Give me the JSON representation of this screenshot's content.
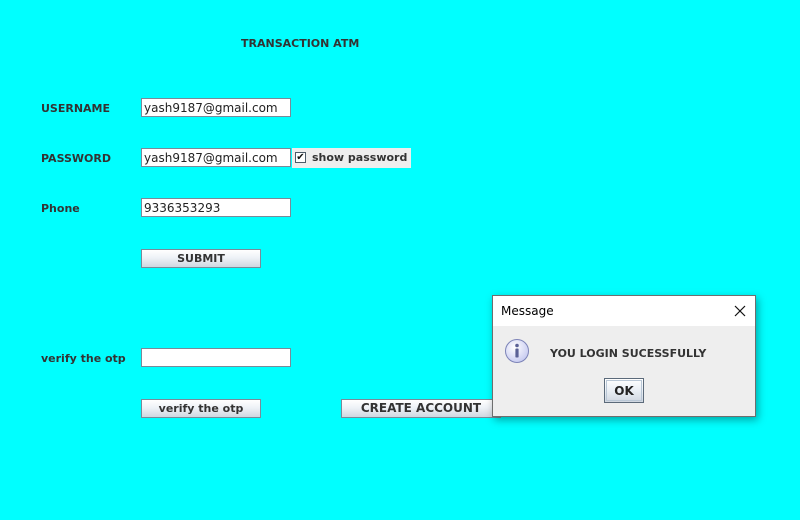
{
  "colors": {
    "background": "#00ffff",
    "dialog_bg": "#eeeeee"
  },
  "form": {
    "title": "TRANSACTION ATM",
    "username_label": "USERNAME",
    "username_value": "yash9187@gmail.com",
    "password_label": "PASSWORD",
    "password_value": "yash9187@gmail.com",
    "show_password_label": "show password",
    "show_password_checked": true,
    "phone_label": "Phone",
    "phone_value": "9336353293",
    "submit_label": "SUBMIT",
    "otp_label": "verify the otp",
    "otp_value": "",
    "verify_button_label": "verify the otp",
    "create_account_label": "CREATE ACCOUNT"
  },
  "dialog": {
    "title": "Message",
    "icon": "info-icon",
    "message": "YOU LOGIN SUCESSFULLY",
    "ok_label": "OK"
  }
}
